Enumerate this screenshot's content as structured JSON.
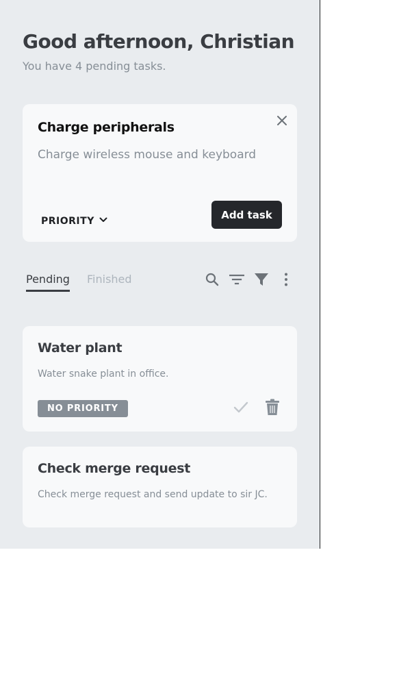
{
  "header": {
    "greeting": "Good afternoon, Christian",
    "subtitle": "You have 4 pending tasks."
  },
  "new_task": {
    "title": "Charge peripherals",
    "description": "Charge wireless mouse and keyboard",
    "priority_label": "PRIORITY",
    "add_label": "Add task"
  },
  "tabs": [
    {
      "label": "Pending",
      "active": true
    },
    {
      "label": "Finished",
      "active": false
    }
  ],
  "toolbar_icons": [
    "search-icon",
    "sort-icon",
    "filter-icon",
    "more-vertical-icon"
  ],
  "tasks": [
    {
      "title": "Water plant",
      "description": "Water snake plant in office.",
      "priority": "NO PRIORITY"
    },
    {
      "title": "Check merge request",
      "description": "Check merge request and send update to sir JC."
    }
  ],
  "colors": {
    "panel_bg": "#e9ecef",
    "card_bg": "#f8f9fa",
    "primary_button": "#25272b",
    "muted_text": "#868e96",
    "badge_bg": "#868e96"
  }
}
